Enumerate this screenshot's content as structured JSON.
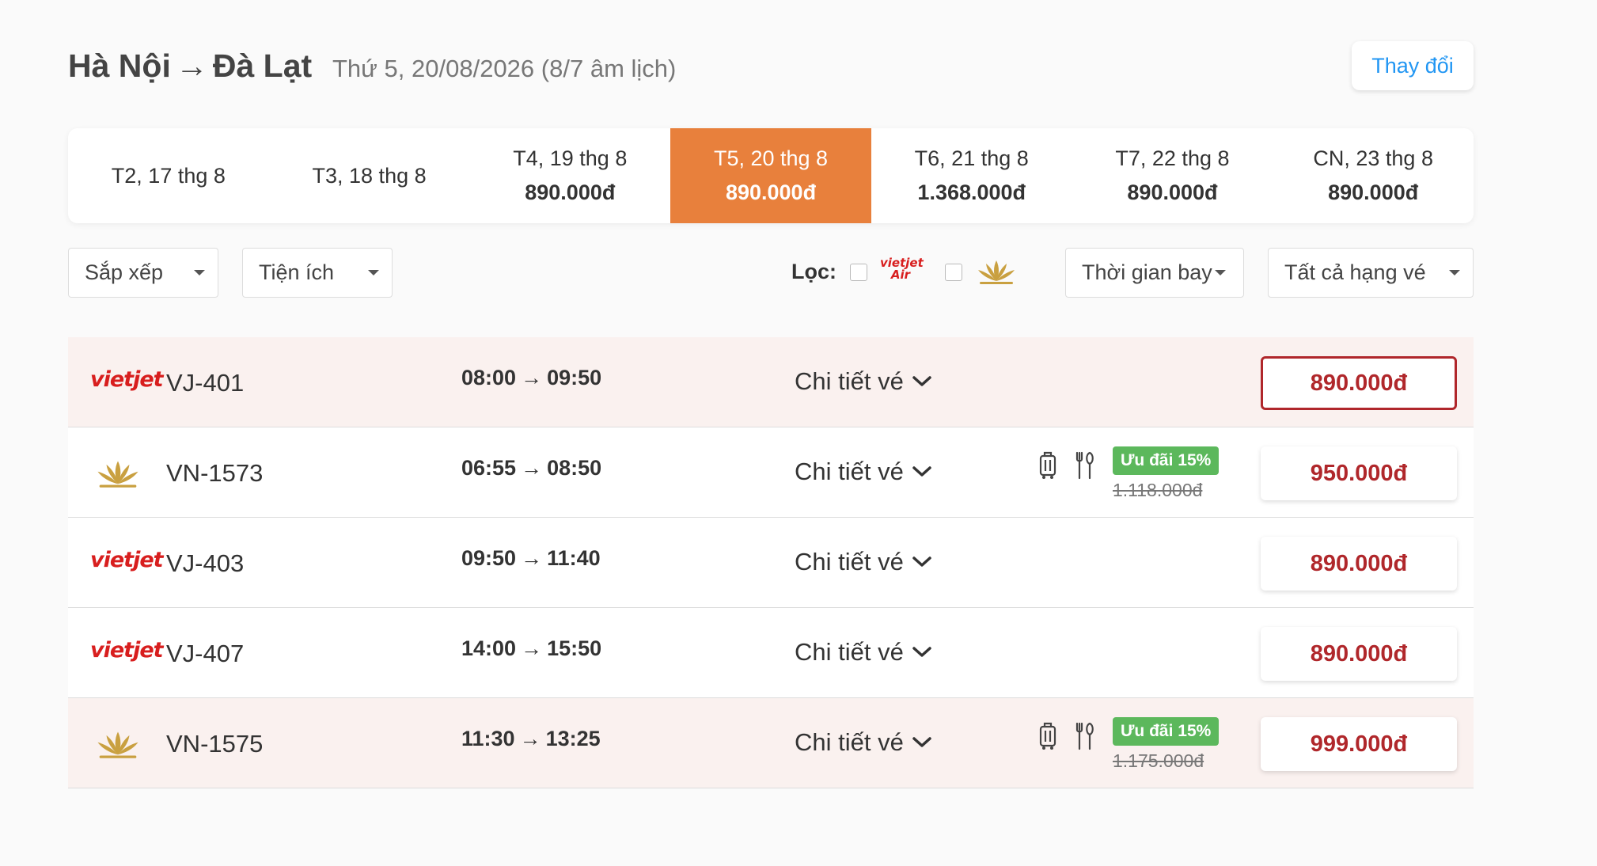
{
  "header": {
    "origin": "Hà Nội",
    "arrow": "→",
    "destination": "Đà Lạt",
    "date": "Thứ 5, 20/08/2026",
    "lunar": "(8/7 âm lịch)",
    "change_label": "Thay đổi"
  },
  "date_tabs": [
    {
      "label": "T2, 17 thg 8",
      "price": ""
    },
    {
      "label": "T3, 18 thg 8",
      "price": ""
    },
    {
      "label": "T4, 19 thg 8",
      "price": "890.000đ"
    },
    {
      "label": "T5, 20 thg 8",
      "price": "890.000đ",
      "active": true
    },
    {
      "label": "T6, 21 thg 8",
      "price": "1.368.000đ"
    },
    {
      "label": "T7, 22 thg 8",
      "price": "890.000đ"
    },
    {
      "label": "CN, 23 thg 8",
      "price": "890.000đ"
    }
  ],
  "filters": {
    "sort_label": "Sắp xếp",
    "amenities_label": "Tiện ích",
    "filter_label": "Lọc:",
    "vietjet_logo_text": "vietjet Air",
    "flight_time_label": "Thời gian bay",
    "ticket_class_label": "Tất cả hạng vé"
  },
  "flights": [
    {
      "airline": "vietjet",
      "logo_text": "vietjet",
      "number": "VJ-401",
      "depart": "08:00",
      "arrive": "09:50",
      "detail_label": "Chi tiết vé",
      "price": "890.000đ",
      "selected": true,
      "tinted": true
    },
    {
      "airline": "vietnam-airlines",
      "number": "VN-1573",
      "depart": "06:55",
      "arrive": "08:50",
      "detail_label": "Chi tiết vé",
      "promo": "Ưu đãi 15%",
      "old_price": "1.118.000đ",
      "price": "950.000đ",
      "amenities": [
        "luggage-icon",
        "meal-icon"
      ]
    },
    {
      "airline": "vietjet",
      "logo_text": "vietjet",
      "number": "VJ-403",
      "depart": "09:50",
      "arrive": "11:40",
      "detail_label": "Chi tiết vé",
      "price": "890.000đ"
    },
    {
      "airline": "vietjet",
      "logo_text": "vietjet",
      "number": "VJ-407",
      "depart": "14:00",
      "arrive": "15:50",
      "detail_label": "Chi tiết vé",
      "price": "890.000đ"
    },
    {
      "airline": "vietnam-airlines",
      "number": "VN-1575",
      "depart": "11:30",
      "arrive": "13:25",
      "detail_label": "Chi tiết vé",
      "promo": "Ưu đãi 15%",
      "old_price": "1.175.000đ",
      "price": "999.000đ",
      "amenities": [
        "luggage-icon",
        "meal-icon"
      ],
      "tinted": true
    }
  ],
  "colors": {
    "accent": "#e8803c",
    "price": "#b0272b",
    "promo": "#5cb85c",
    "link": "#2196f3",
    "vietjet_red": "#d81e1e",
    "lotus_gold": "#c9a040"
  }
}
